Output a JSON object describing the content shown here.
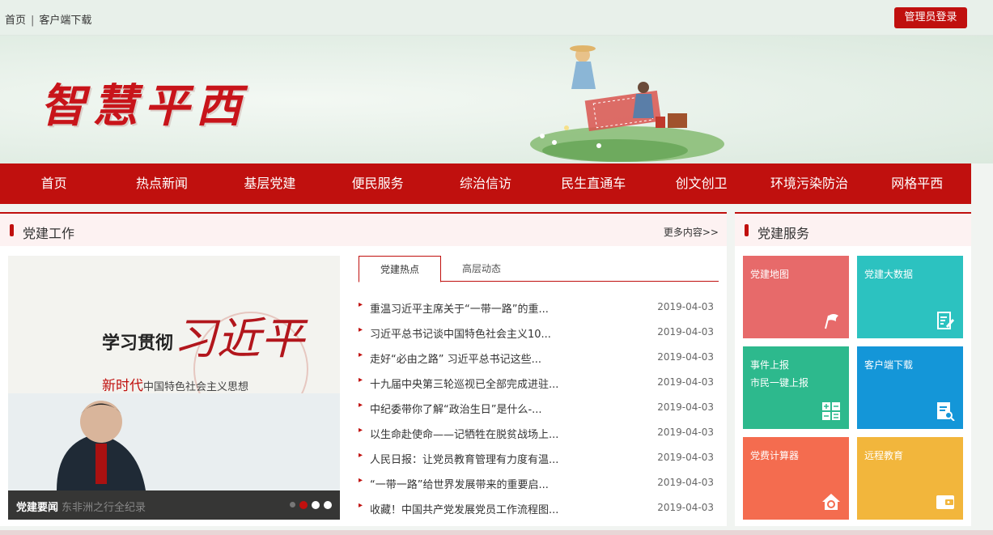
{
  "top": {
    "links": [
      "首页",
      "客户端下载"
    ],
    "separator": "|",
    "admin_login": "管理员登录"
  },
  "brand": {
    "title": "智慧平西"
  },
  "nav": [
    "首页",
    "热点新闻",
    "基层党建",
    "便民服务",
    "综治信访",
    "民生直通车",
    "创文创卫",
    "环境污染防治",
    "网格平西"
  ],
  "party_work": {
    "title": "党建工作",
    "more": "更多内容>>",
    "slide": {
      "poster_line1": "学习贯彻",
      "poster_calligraphy": "习近平",
      "poster_line2_red": "新时代",
      "poster_line2": "中国特色社会主义思想",
      "caption": "党建要闻",
      "caption_overlay": "东非洲之行全纪录",
      "dot_count": 4,
      "active_dot": 1
    },
    "tabs": [
      "党建热点",
      "高层动态"
    ],
    "news": [
      {
        "title": "重温习近平主席关于“一带一路”的重...",
        "date": "2019-04-03"
      },
      {
        "title": "习近平总书记谈中国特色社会主义10...",
        "date": "2019-04-03"
      },
      {
        "title": "走好“必由之路” 习近平总书记这些...",
        "date": "2019-04-03"
      },
      {
        "title": "十九届中央第三轮巡视已全部完成进驻...",
        "date": "2019-04-03"
      },
      {
        "title": "中纪委带你了解“政治生日”是什么-...",
        "date": "2019-04-03"
      },
      {
        "title": "以生命赴使命——记牺牲在脱贫战场上...",
        "date": "2019-04-03"
      },
      {
        "title": "人民日报：让党员教育管理有力度有温...",
        "date": "2019-04-03"
      },
      {
        "title": "“一带一路”给世界发展带来的重要启...",
        "date": "2019-04-03"
      },
      {
        "title": "收藏！中国共产党发展党员工作流程图...",
        "date": "2019-04-03"
      }
    ]
  },
  "party_service": {
    "title": "党建服务",
    "tiles": [
      {
        "label": "党建地图",
        "sub": "",
        "color": "#e76a6a",
        "icon": "flag-icon"
      },
      {
        "label": "党建大数据",
        "sub": "",
        "color": "#2cc2c0",
        "icon": "document-edit-icon"
      },
      {
        "label": "事件上报",
        "sub": "市民一键上报",
        "color": "#2db98d",
        "icon": "calculator-grid-icon"
      },
      {
        "label": "客户端下载",
        "sub": "",
        "color": "#1496d8",
        "icon": "document-search-icon"
      },
      {
        "label": "党费计算器",
        "sub": "",
        "color": "#f46c4f",
        "icon": "home-badge-icon"
      },
      {
        "label": "远程教育",
        "sub": "",
        "color": "#f2b63c",
        "icon": "wallet-icon"
      }
    ]
  }
}
